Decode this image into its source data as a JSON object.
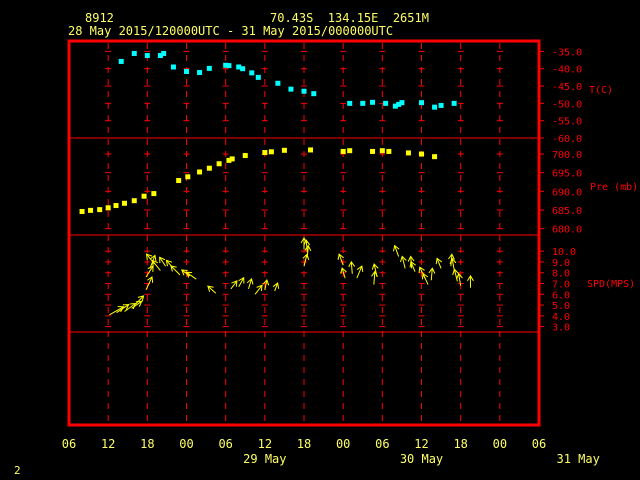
{
  "header": {
    "station": "8912",
    "location": "70.43S  134.15E  2651M",
    "period": "28 May 2015/120000UTC - 31 May 2015/000000UTC"
  },
  "footer": {
    "page_number": "2"
  },
  "colors": {
    "frame": "#ff0000",
    "grid": "#ff0000",
    "axis_labels": "#ff0000",
    "time_labels": "#ffff66",
    "temperature": "#00ffff",
    "pressure": "#ffff00",
    "wind": "#ffff00",
    "header": "#ffff66"
  },
  "chart_data": {
    "type": "scatter",
    "x_axis": {
      "range_hours": [
        -6,
        66
      ],
      "tick_labels": [
        "06",
        "12",
        "18",
        "00",
        "06",
        "12",
        "18",
        "00",
        "06",
        "12",
        "18",
        "00",
        "06"
      ],
      "day_labels": [
        {
          "label": "29 May",
          "hour": 24
        },
        {
          "label": "30 May",
          "hour": 48
        },
        {
          "label": "31 May",
          "hour": 72
        }
      ]
    },
    "panels": [
      {
        "name": "temperature",
        "label": "T(C)",
        "ylim": [
          -60,
          -32
        ],
        "ticks": [
          -35,
          -40,
          -45,
          -50,
          -55,
          -60
        ],
        "tick_labels": [
          "-35.0",
          "-40.0",
          "-45.0",
          "-50.0",
          "-55.0",
          "-60.0"
        ],
        "points": [
          [
            2,
            -37.9
          ],
          [
            4,
            -35.6
          ],
          [
            6,
            -36.2
          ],
          [
            8,
            -36.2
          ],
          [
            8.5,
            -35.6
          ],
          [
            10,
            -39.5
          ],
          [
            12,
            -40.8
          ],
          [
            14,
            -41.1
          ],
          [
            15.5,
            -39.9
          ],
          [
            18,
            -39.0
          ],
          [
            18.5,
            -39.1
          ],
          [
            20,
            -39.5
          ],
          [
            20.6,
            -40.0
          ],
          [
            22,
            -41.2
          ],
          [
            23,
            -42.5
          ],
          [
            26,
            -44.2
          ],
          [
            28,
            -45.9
          ],
          [
            30,
            -46.5
          ],
          [
            31.5,
            -47.2
          ],
          [
            37,
            -50.0
          ],
          [
            39,
            -50.0
          ],
          [
            40.5,
            -49.7
          ],
          [
            42.5,
            -50.0
          ],
          [
            44,
            -50.8
          ],
          [
            44.5,
            -50.3
          ],
          [
            45,
            -49.8
          ],
          [
            48,
            -49.8
          ],
          [
            50,
            -51.1
          ],
          [
            51,
            -50.6
          ],
          [
            53,
            -50.0
          ]
        ]
      },
      {
        "name": "pressure",
        "label": "Pre (mb)",
        "ylim": [
          678.3,
          704.3
        ],
        "ticks": [
          680,
          685,
          690,
          695,
          700
        ],
        "tick_labels": [
          "680.0",
          "685.0",
          "690.0",
          "695.0",
          "700.0"
        ],
        "points": [
          [
            -4,
            684.6
          ],
          [
            -2.7,
            684.9
          ],
          [
            -1.3,
            685.1
          ],
          [
            0,
            685.6
          ],
          [
            1.2,
            686.2
          ],
          [
            2.5,
            686.8
          ],
          [
            4,
            687.5
          ],
          [
            5.5,
            688.7
          ],
          [
            7,
            689.4
          ],
          [
            10.8,
            692.9
          ],
          [
            12.2,
            693.9
          ],
          [
            14,
            695.2
          ],
          [
            15.5,
            696.2
          ],
          [
            17,
            697.4
          ],
          [
            18.5,
            698.3
          ],
          [
            19,
            698.7
          ],
          [
            21,
            699.6
          ],
          [
            24,
            700.4
          ],
          [
            25,
            700.6
          ],
          [
            27,
            701.0
          ],
          [
            31,
            701.1
          ],
          [
            36,
            700.7
          ],
          [
            37,
            700.9
          ],
          [
            40.5,
            700.7
          ],
          [
            42,
            700.9
          ],
          [
            43,
            700.7
          ],
          [
            46,
            700.3
          ],
          [
            48,
            700.0
          ],
          [
            50,
            699.3
          ]
        ]
      },
      {
        "name": "wind",
        "label": "SPD(MPS)",
        "ylim": [
          2.5,
          11.5
        ],
        "ticks": [
          3,
          4,
          5,
          6,
          7,
          8,
          9,
          10
        ],
        "tick_labels": [
          "3.0",
          "4.0",
          "5.0",
          "6.0",
          "7.0",
          "8.0",
          "9.0",
          "10.0"
        ],
        "points": [
          {
            "x": 0.2,
            "speed": 4.1,
            "dx": 14,
            "dy": -8
          },
          {
            "x": 1.3,
            "speed": 4.3,
            "dx": 12,
            "dy": -8
          },
          {
            "x": 2.5,
            "speed": 4.4,
            "dx": 11,
            "dy": -8
          },
          {
            "x": 3.6,
            "speed": 4.7,
            "dx": 10,
            "dy": -7
          },
          {
            "x": 4.2,
            "speed": 5.1,
            "dx": 8,
            "dy": -8
          },
          {
            "x": 5.8,
            "speed": 6.4,
            "dx": 6,
            "dy": -13
          },
          {
            "x": 5.8,
            "speed": 7.6,
            "dx": 7,
            "dy": -11
          },
          {
            "x": 6.4,
            "speed": 8.4,
            "dx": 5,
            "dy": -13
          },
          {
            "x": 7.1,
            "speed": 8.8,
            "dx": -8,
            "dy": -10
          },
          {
            "x": 8.0,
            "speed": 8.2,
            "dx": -8,
            "dy": -10
          },
          {
            "x": 8.8,
            "speed": 8.6,
            "dx": -6,
            "dy": -9
          },
          {
            "x": 10.0,
            "speed": 8.4,
            "dx": -7,
            "dy": -8
          },
          {
            "x": 11.0,
            "speed": 7.8,
            "dx": -9,
            "dy": -9
          },
          {
            "x": 12.5,
            "speed": 7.7,
            "dx": -8,
            "dy": -6
          },
          {
            "x": 13.5,
            "speed": 7.4,
            "dx": -10,
            "dy": -7
          },
          {
            "x": 16.5,
            "speed": 6.1,
            "dx": -8,
            "dy": -7
          },
          {
            "x": 18.8,
            "speed": 6.5,
            "dx": 6,
            "dy": -8
          },
          {
            "x": 20.0,
            "speed": 6.7,
            "dx": 5,
            "dy": -9
          },
          {
            "x": 21.5,
            "speed": 6.5,
            "dx": 3,
            "dy": -10
          },
          {
            "x": 22.5,
            "speed": 6.0,
            "dx": 7,
            "dy": -9
          },
          {
            "x": 24.0,
            "speed": 6.4,
            "dx": 2,
            "dy": -10
          },
          {
            "x": 25.5,
            "speed": 6.3,
            "dx": 3,
            "dy": -8
          },
          {
            "x": 30.0,
            "speed": 8.6,
            "dx": 3,
            "dy": -12
          },
          {
            "x": 30.5,
            "speed": 9.4,
            "dx": 1,
            "dy": -12
          },
          {
            "x": 30.5,
            "speed": 9.9,
            "dx": -1,
            "dy": -12
          },
          {
            "x": 30.0,
            "speed": 10.2,
            "dx": 0,
            "dy": -11
          },
          {
            "x": 36.0,
            "speed": 8.7,
            "dx": -4,
            "dy": -11
          },
          {
            "x": 36.3,
            "speed": 7.5,
            "dx": -3,
            "dy": -10
          },
          {
            "x": 37.4,
            "speed": 7.9,
            "dx": -1,
            "dy": -12
          },
          {
            "x": 38.1,
            "speed": 7.5,
            "dx": 5,
            "dy": -12
          },
          {
            "x": 40.7,
            "speed": 6.9,
            "dx": 1,
            "dy": -13
          },
          {
            "x": 41.2,
            "speed": 7.6,
            "dx": -3,
            "dy": -13
          },
          {
            "x": 44.5,
            "speed": 9.5,
            "dx": -4,
            "dy": -11
          },
          {
            "x": 45.5,
            "speed": 8.4,
            "dx": -3,
            "dy": -12
          },
          {
            "x": 46.5,
            "speed": 8.4,
            "dx": -1,
            "dy": -12
          },
          {
            "x": 47.0,
            "speed": 8.1,
            "dx": -4,
            "dy": -10
          },
          {
            "x": 48.5,
            "speed": 7.5,
            "dx": -5,
            "dy": -11
          },
          {
            "x": 49.0,
            "speed": 6.9,
            "dx": -5,
            "dy": -11
          },
          {
            "x": 49.5,
            "speed": 7.3,
            "dx": 1,
            "dy": -12
          },
          {
            "x": 51.0,
            "speed": 8.4,
            "dx": -4,
            "dy": -10
          },
          {
            "x": 52.5,
            "speed": 8.6,
            "dx": 1,
            "dy": -12
          },
          {
            "x": 53.0,
            "speed": 8.3,
            "dx": -2,
            "dy": -11
          },
          {
            "x": 53.5,
            "speed": 7.2,
            "dx": -3,
            "dy": -12
          },
          {
            "x": 54.0,
            "speed": 6.8,
            "dx": -2,
            "dy": -12
          },
          {
            "x": 55.5,
            "speed": 6.6,
            "dx": 0,
            "dy": -12
          }
        ]
      }
    ]
  }
}
